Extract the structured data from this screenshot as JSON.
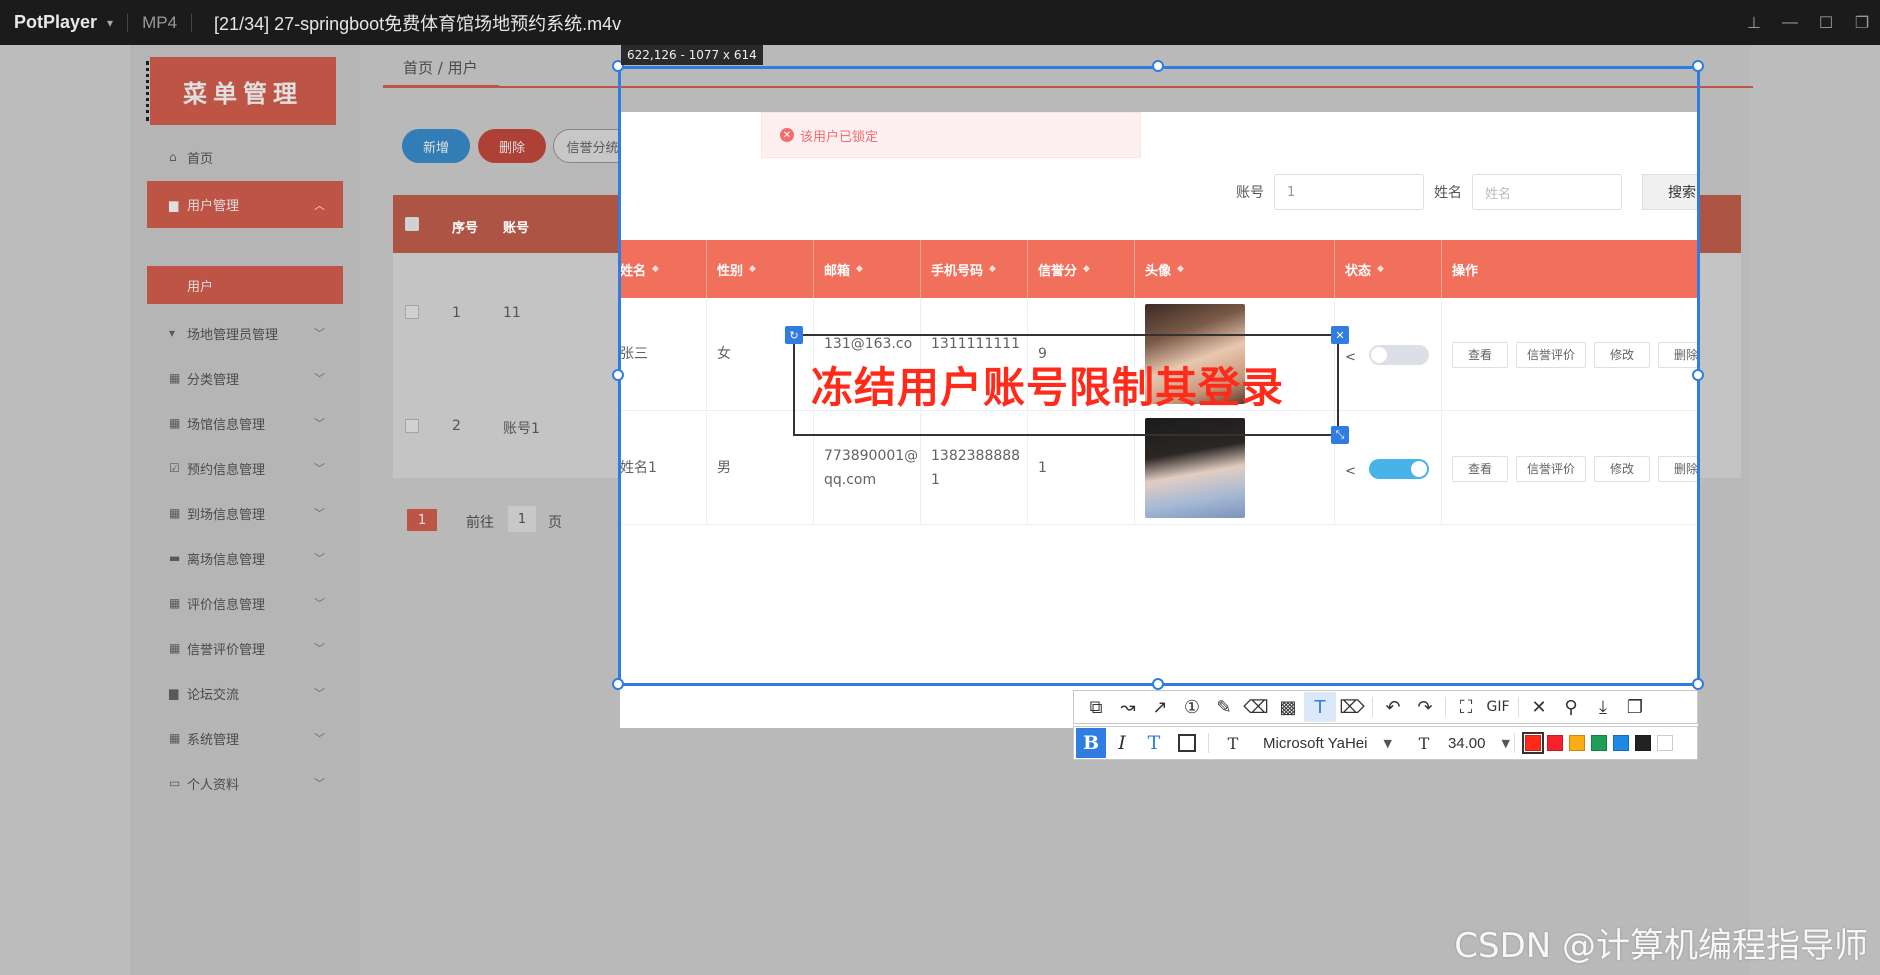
{
  "titlebar": {
    "app_name": "PotPlayer",
    "format": "MP4",
    "file_title": "[21/34] 27-springboot免费体育馆场地预约系统.m4v",
    "controls": [
      "pin-icon",
      "minimize-icon",
      "maximize-icon",
      "restore-icon"
    ]
  },
  "sidebar": {
    "header": "菜单管理",
    "items": [
      {
        "label": "首页",
        "icon": "home-icon"
      },
      {
        "label": "用户管理",
        "icon": "user-icon",
        "active": true
      },
      {
        "label": "场地管理员管理",
        "icon": "person-icon"
      },
      {
        "label": "分类管理",
        "icon": "grid-icon"
      },
      {
        "label": "场馆信息管理",
        "icon": "grid-icon"
      },
      {
        "label": "预约信息管理",
        "icon": "check-icon"
      },
      {
        "label": "到场信息管理",
        "icon": "grid-icon"
      },
      {
        "label": "离场信息管理",
        "icon": "bag-icon"
      },
      {
        "label": "评价信息管理",
        "icon": "grid-icon"
      },
      {
        "label": "信誉评价管理",
        "icon": "grid-icon"
      },
      {
        "label": "论坛交流",
        "icon": "chat-icon"
      },
      {
        "label": "系统管理",
        "icon": "grid-icon"
      },
      {
        "label": "个人资料",
        "icon": "card-icon"
      }
    ],
    "sub_item": "用户"
  },
  "breadcrumb": "首页 / 用户",
  "toolbar": {
    "add": "新增",
    "delete": "删除",
    "stats": "信誉分统计"
  },
  "alert": "该用户已锁定",
  "search": {
    "account_label": "账号",
    "account_value": "1",
    "name_label": "姓名",
    "name_placeholder": "姓名",
    "button": "搜索"
  },
  "table": {
    "headers": [
      "序号",
      "账号",
      "姓名",
      "性别",
      "邮箱",
      "手机号码",
      "信誉分",
      "头像",
      "状态",
      "操作"
    ],
    "rows": [
      {
        "index": "1",
        "account": "11",
        "name": "张三",
        "gender": "女",
        "email": "131@163.co",
        "phone": "1311111111",
        "score": "9",
        "status_on": false
      },
      {
        "index": "2",
        "account": "账号1",
        "name": "姓名1",
        "gender": "男",
        "email": "773890001@qq.com",
        "phone": "13823888881",
        "score": "1",
        "status_on": true
      }
    ],
    "actions": [
      "查看",
      "信誉评价",
      "修改",
      "删除"
    ]
  },
  "pagination": {
    "current": "1",
    "goto_label": "前往",
    "goto_value": "1",
    "page_suffix": "页"
  },
  "annotation": {
    "text": "冻结用户账号限制其登录",
    "color": "#ff2a1a"
  },
  "capture": {
    "size_label": "622,126 - 1077 x 614",
    "tools": [
      "shape-icon",
      "polyline-icon",
      "arrow-icon",
      "number-icon",
      "pen-icon",
      "highlighter-icon",
      "mosaic-icon",
      "text-icon",
      "eraser-icon",
      "undo-icon",
      "redo-icon",
      "record-icon",
      "gif-icon",
      "close-icon",
      "pin-icon",
      "download-icon",
      "copy-icon"
    ],
    "gif_label": "GIF",
    "font_name": "Microsoft YaHei",
    "font_size": "34.00",
    "colors": [
      "#ff2a1a",
      "#f5222d",
      "#faad14",
      "#1f9e5a",
      "#1e88e5",
      "#222222",
      "#ffffff"
    ]
  },
  "watermark": "CSDN @计算机编程指导师",
  "accent": "#d96050"
}
